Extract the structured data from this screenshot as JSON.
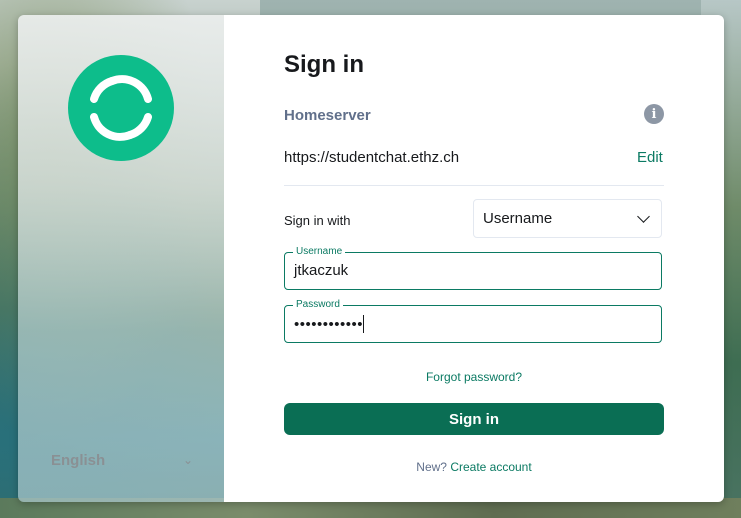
{
  "colors": {
    "brand": "#0dbd8b",
    "accent": "#0b7a63",
    "button_bg": "#0a6e54"
  },
  "sidebar": {
    "logo_icon": "element-logo-icon",
    "language": "English"
  },
  "form": {
    "title": "Sign in",
    "homeserver_label": "Homeserver",
    "homeserver_url": "https://studentchat.ethz.ch",
    "edit_label": "Edit",
    "signin_with_label": "Sign in with",
    "signin_with_value": "Username",
    "username_label": "Username",
    "username_value": "jtkaczuk",
    "password_label": "Password",
    "password_value": "••••••••••••",
    "forgot_label": "Forgot password?",
    "submit_label": "Sign in",
    "new_prefix": "New?",
    "create_account_label": "Create account"
  }
}
